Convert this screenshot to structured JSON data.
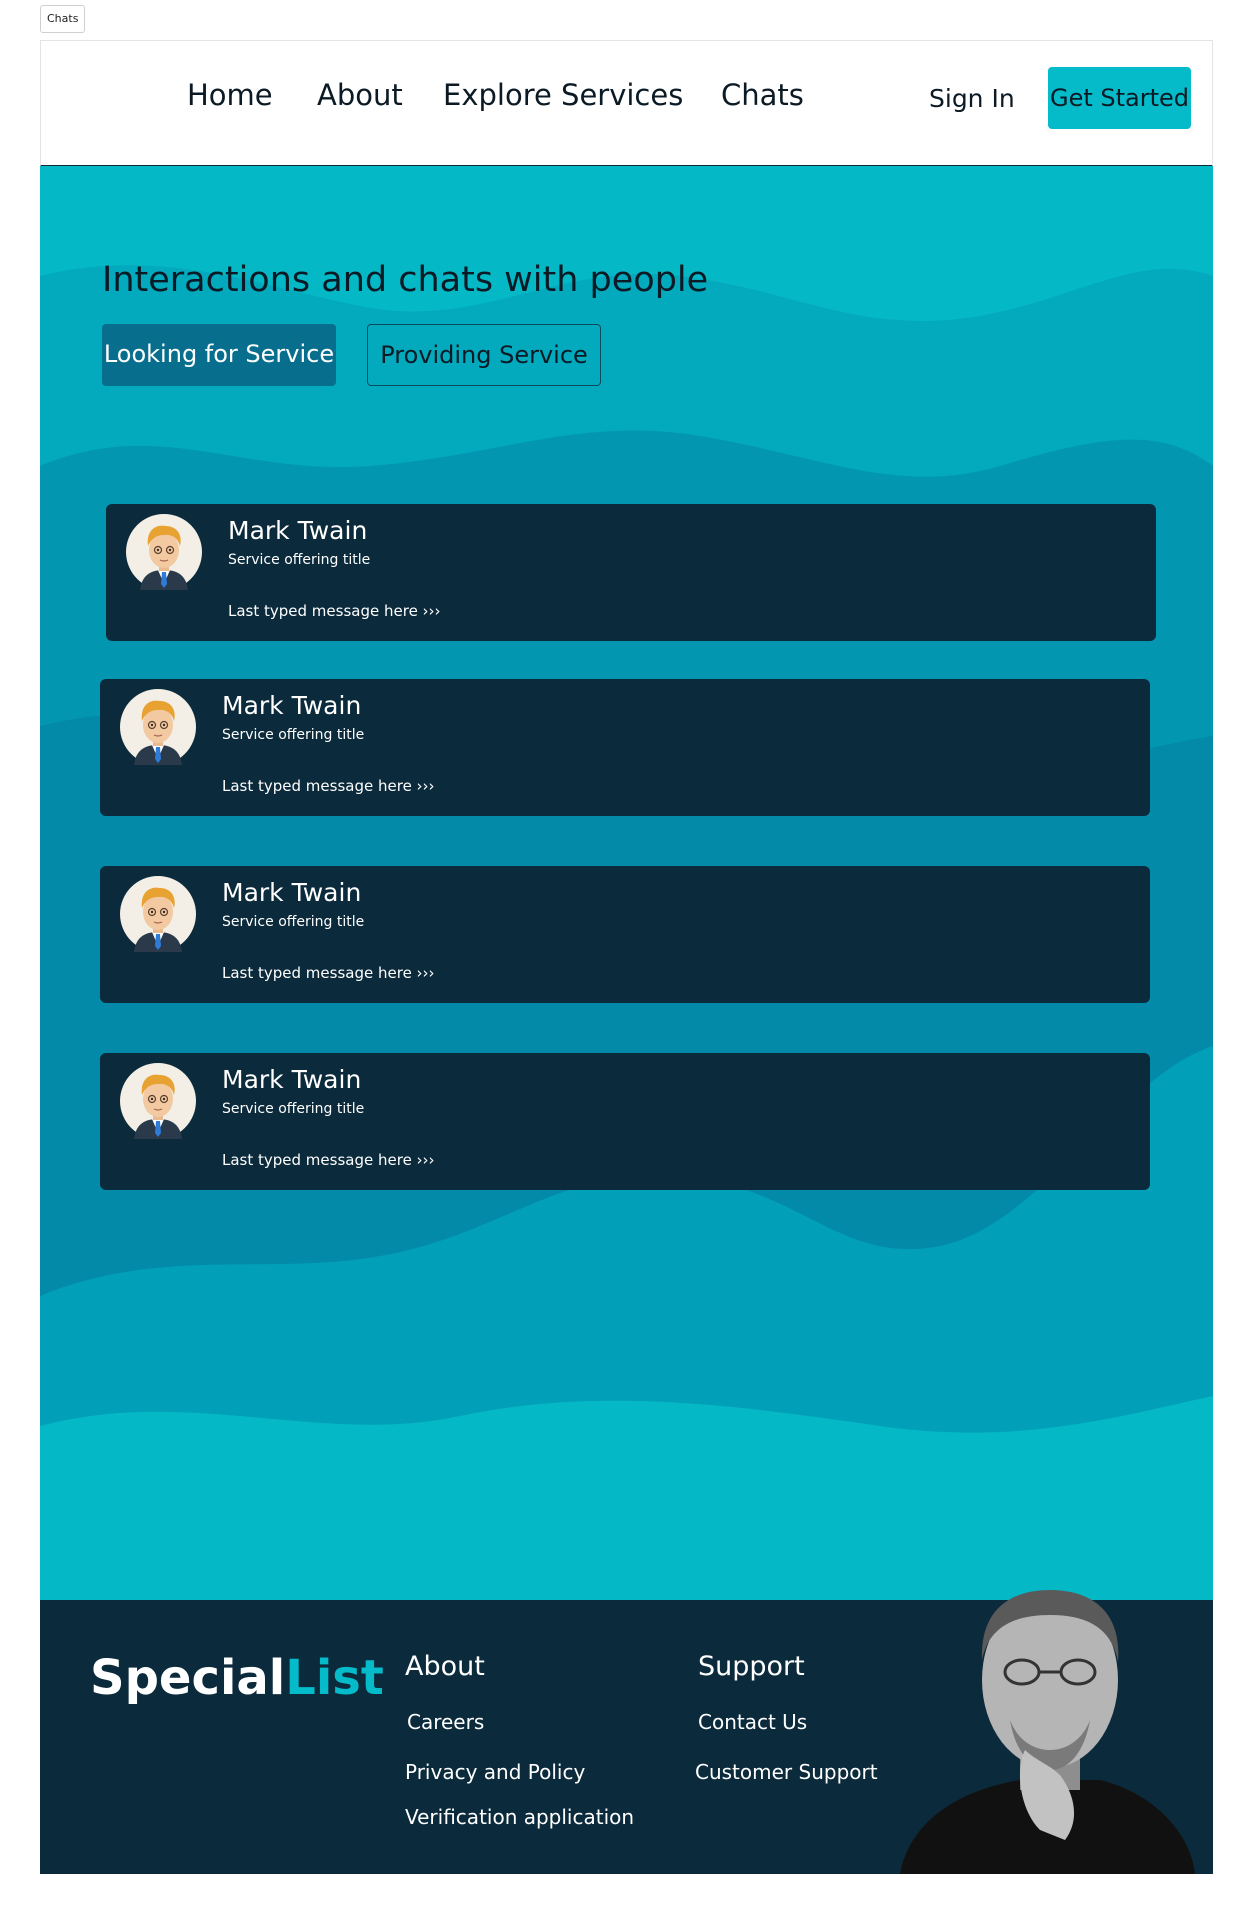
{
  "tab_label": "Chats",
  "nav": {
    "home": "Home",
    "about": "About",
    "explore": "Explore Services",
    "chats": "Chats",
    "sign_in": "Sign In",
    "get_started": "Get Started"
  },
  "hero": {
    "title": "Interactions and chats with people",
    "tab_looking": "Looking for Service",
    "tab_providing": "Providing Service"
  },
  "chats": [
    {
      "name": "Mark Twain",
      "subtitle": "Service offering title",
      "message": "Last typed message here ›››"
    },
    {
      "name": "Mark Twain",
      "subtitle": "Service offering title",
      "message": "Last typed message here ›››"
    },
    {
      "name": "Mark Twain",
      "subtitle": "Service offering title",
      "message": "Last typed message here ›››"
    },
    {
      "name": "Mark Twain",
      "subtitle": "Service offering title",
      "message": "Last typed message here ›››"
    }
  ],
  "footer": {
    "logo_main": "Special",
    "logo_accent": "List",
    "about_heading": "About",
    "about_links": [
      "Careers",
      "Privacy and Policy",
      "Verification application"
    ],
    "support_heading": "Support",
    "support_links": [
      "Contact Us",
      "Customer Support"
    ]
  },
  "colors": {
    "accent": "#05bac9",
    "dark": "#0b2a3b",
    "active_tab": "#076f8d"
  }
}
